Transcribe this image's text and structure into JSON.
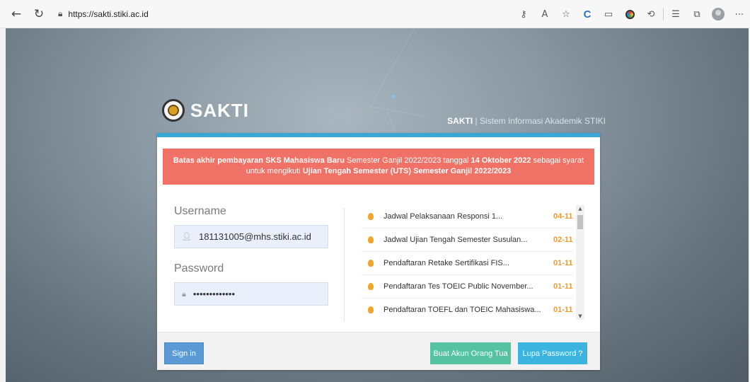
{
  "browser": {
    "url": "https://sakti.stiki.ac.id",
    "icons": [
      "key-icon",
      "read-aloud-icon",
      "favorite-star-icon",
      "c-extension-icon",
      "reader-icon",
      "color-circle-icon",
      "puzzle-icon",
      "favorites-list-icon",
      "collections-icon",
      "profile-avatar-icon",
      "more-icon"
    ]
  },
  "header": {
    "logo_text": "SAKTI",
    "subtitle_brand": "SAKTI",
    "subtitle_rest": " | Sistem Informasi Akademik STIKI"
  },
  "alert": {
    "part1_bold": "Batas akhir pembayaran SKS Mahasiswa Baru",
    "part2": " Semester Ganjil 2022/2023 tanggal ",
    "part3_bold": "14 Oktober 2022",
    "part4": " sebagai syarat untuk mengikuti ",
    "part5_bold": "Ujian Tengah Semester (UTS) Semester Ganjil 2022/2023",
    "color": "#f07266"
  },
  "login": {
    "username_label": "Username",
    "username_value": "181131005@mhs.stiki.ac.id",
    "password_label": "Password",
    "password_value": "•••••••••••••"
  },
  "news": [
    {
      "title": "Jadwal Pelaksanaan Responsi 1...",
      "date": "04-11"
    },
    {
      "title": "Jadwal Ujian Tengah Semester Susulan...",
      "date": "02-11"
    },
    {
      "title": "Pendaftaran Retake Sertifikasi FIS...",
      "date": "01-11"
    },
    {
      "title": "Pendaftaran Tes TOEIC Public November...",
      "date": "01-11"
    },
    {
      "title": "Pendaftaran TOEFL dan TOEIC Mahasiswa...",
      "date": "01-11"
    }
  ],
  "buttons": {
    "signin": "Sign in",
    "buat_akun": "Buat Akun Orang Tua",
    "lupa_password": "Lupa Password ?"
  },
  "colors": {
    "accent_blue": "#3aa6d6",
    "signin": "#5b9bd5",
    "green": "#55c3a0",
    "cyan": "#3bb5e0",
    "news_date": "#f09a2a"
  }
}
